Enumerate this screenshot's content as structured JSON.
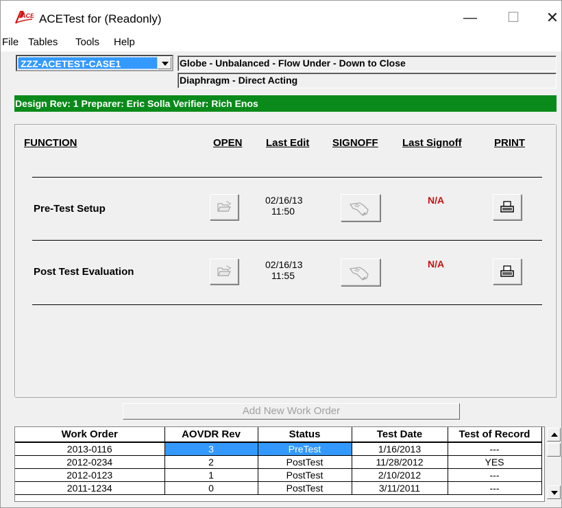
{
  "window": {
    "title": "ACETest for  (Readonly)",
    "logo_text": "ACE",
    "minimize": "—",
    "maximize": "☐",
    "close": "✕"
  },
  "menu": [
    "File",
    "Tables",
    "Tools",
    "Help"
  ],
  "case_select": {
    "value": "ZZZ-ACETEST-CASE1"
  },
  "info": {
    "line1": "Globe - Unbalanced - Flow Under - Down to Close",
    "line2": "Diaphragm - Direct Acting"
  },
  "design_bar": {
    "text": "Design Rev: 1   Preparer: Eric Solla  Verifier: Rich Enos",
    "color": "#0a8a1a"
  },
  "functions": {
    "headers": {
      "function": "FUNCTION",
      "open": "OPEN",
      "last_edit": "Last Edit",
      "signoff": "SIGNOFF",
      "last_signoff": "Last Signoff",
      "print": "PRINT"
    },
    "rows": [
      {
        "label": "Pre-Test Setup",
        "edit_date": "02/16/13",
        "edit_time": "11:50",
        "last_signoff": "N/A"
      },
      {
        "label": "Post Test Evaluation",
        "edit_date": "02/16/13",
        "edit_time": "11:55",
        "last_signoff": "N/A"
      }
    ],
    "icons": {
      "open": "folder-open-icon",
      "signoff": "signoff-hand-icon",
      "print": "printer-icon"
    }
  },
  "add_work_order": {
    "label": "Add New Work Order"
  },
  "work_orders": {
    "columns": [
      "Work Order",
      "AOVDR Rev",
      "Status",
      "Test Date",
      "Test of Record"
    ],
    "rows": [
      {
        "work_order": "2013-0116",
        "rev": "3",
        "status": "PreTest",
        "test_date": "1/16/2013",
        "record": "---"
      },
      {
        "work_order": "2012-0234",
        "rev": "2",
        "status": "PostTest",
        "test_date": "11/28/2012",
        "record": "YES"
      },
      {
        "work_order": "2012-0123",
        "rev": "1",
        "status": "PostTest",
        "test_date": "2/10/2012",
        "record": "---"
      },
      {
        "work_order": "2011-1234",
        "rev": "0",
        "status": "PostTest",
        "test_date": "3/11/2011",
        "record": "---"
      }
    ]
  },
  "colors": {
    "selection": "#3399ff",
    "na_text": "#cc1010",
    "design_bar": "#0a8a1a"
  }
}
